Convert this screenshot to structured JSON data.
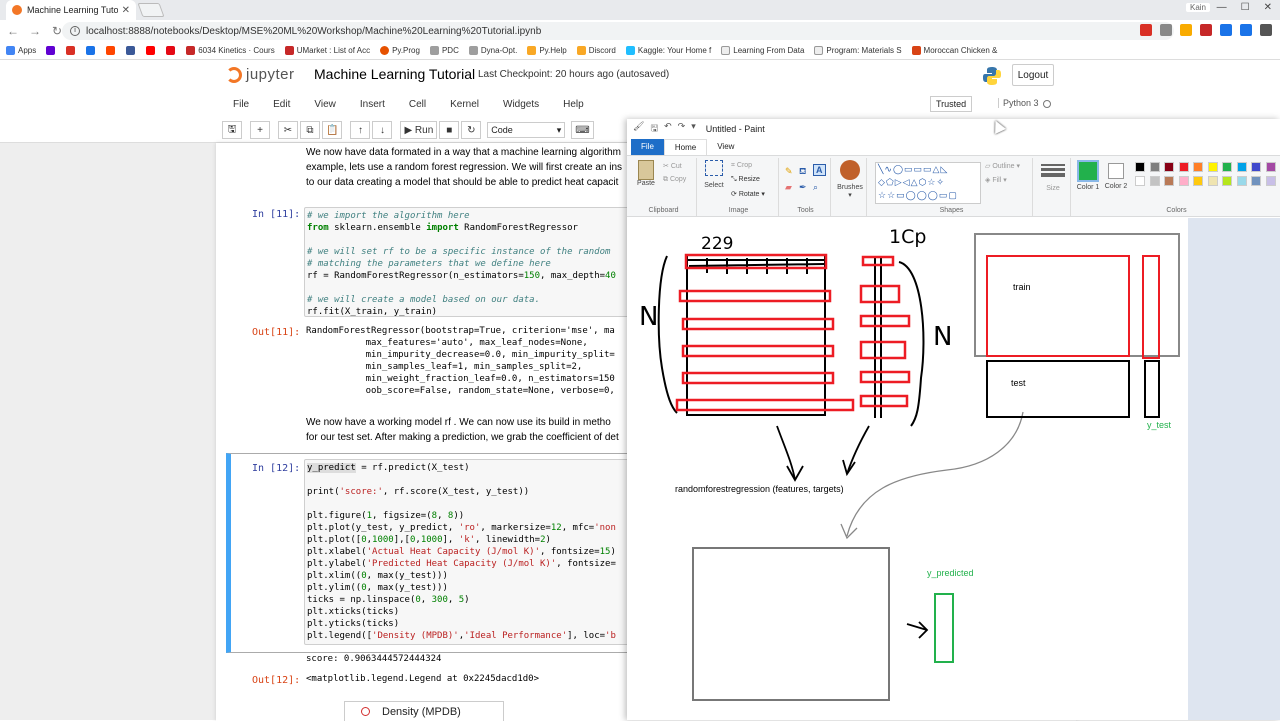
{
  "browser": {
    "tab_title": "Machine Learning Tutori",
    "url": "localhost:8888/notebooks/Desktop/MSE%20ML%20Workshop/Machine%20Learning%20Tutorial.ipynb",
    "profile": "Kain",
    "apps_label": "Apps",
    "bookmarks": [
      "6034 Kinetics · Cours",
      "UMarket : List of Acc",
      "Py.Prog",
      "PDC",
      "Dyna-Opt.",
      "Py.Help",
      "Discord",
      "Kaggle: Your Home f",
      "Learning From Data",
      "Program: Materials S",
      "Moroccan Chicken &"
    ]
  },
  "jupyter": {
    "logo_text": "jupyter",
    "notebook_name": "Machine Learning Tutorial",
    "checkpoint": "Last Checkpoint: 20 hours ago  (autosaved)",
    "logout": "Logout",
    "menus": [
      "File",
      "Edit",
      "View",
      "Insert",
      "Cell",
      "Kernel",
      "Widgets",
      "Help"
    ],
    "trusted": "Trusted",
    "kernel": "Python 3",
    "run_label": "Run",
    "cell_type": "Code"
  },
  "notebook": {
    "md1": [
      "We now have data formated in a way that a machine learning algorithm",
      "example, lets use a random forest regression. We will first create an ins",
      "to our data creating a model that should be able to predict heat capacit"
    ],
    "in11_prompt": "In [11]:",
    "out11_prompt": "Out[11]:",
    "out11_lines": [
      "RandomForestRegressor(bootstrap=True, criterion='mse', ma",
      "           max_features='auto', max_leaf_nodes=None,",
      "           min_impurity_decrease=0.0, min_impurity_split=",
      "           min_samples_leaf=1, min_samples_split=2,",
      "           min_weight_fraction_leaf=0.0, n_estimators=150",
      "           oob_score=False, random_state=None, verbose=0,"
    ],
    "md2": [
      "We now have a working model  rf . We can now use its build in metho",
      "for our test set. After making a prediction, we grab the coefficient of det"
    ],
    "in12_prompt": "In [12]:",
    "score_line": "score: 0.9063444572444324",
    "out12_prompt": "Out[12]:",
    "out12_text": "<matplotlib.legend.Legend at 0x2245dacd1d0>",
    "legend_label": "Density (MPDB)"
  },
  "paint": {
    "title": "Untitled - Paint",
    "tabs": [
      "File",
      "Home",
      "View"
    ],
    "groups": [
      "Clipboard",
      "Image",
      "Tools",
      "Shapes",
      "Colors"
    ],
    "clipboard": {
      "paste": "Paste",
      "cut": "Cut",
      "copy": "Copy"
    },
    "image": {
      "select": "Select",
      "crop": "Crop",
      "resize": "Resize",
      "rotate": "Rotate"
    },
    "brushes": "Brushes",
    "outline": "Outline",
    "fill": "Fill",
    "size": "Size",
    "color1": "Color 1",
    "color2": "Color 2",
    "palette_row1": [
      "#000000",
      "#7f7f7f",
      "#880015",
      "#ed1c24",
      "#ff7f27",
      "#fff200",
      "#22b14c",
      "#00a2e8",
      "#3f48cc",
      "#a349a4"
    ],
    "palette_row2": [
      "#ffffff",
      "#c3c3c3",
      "#b97a57",
      "#ffaec9",
      "#ffc90e",
      "#efe4b0",
      "#b5e61d",
      "#99d9ea",
      "#7092be",
      "#c8bfe7"
    ],
    "drawing": {
      "label_229": "229",
      "label_1cp": "1Cp",
      "label_N_left": "N",
      "label_N_right": "N",
      "train": "train",
      "test": "test",
      "y_test": "y_test",
      "rfr": "randomforestregression (features, targets)",
      "y_predicted": "y_predicted"
    }
  }
}
